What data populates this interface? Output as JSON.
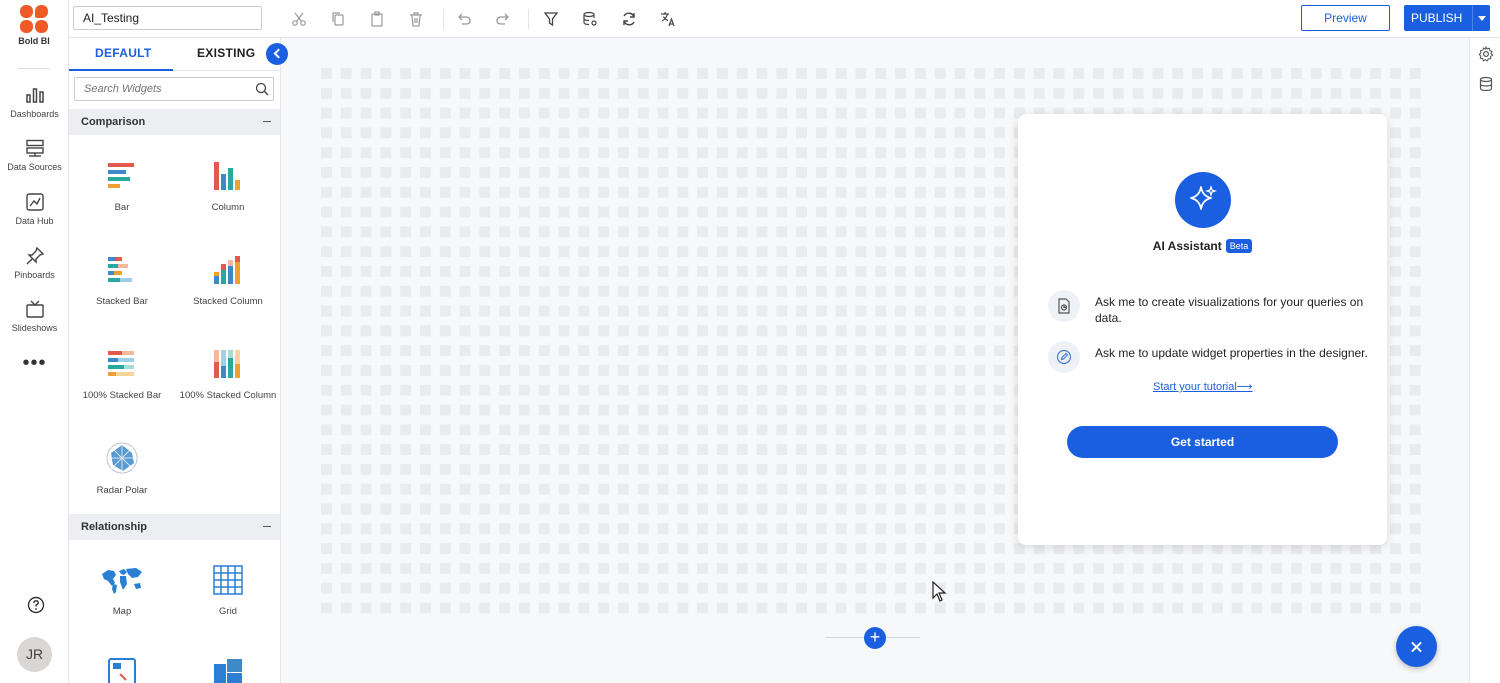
{
  "app": {
    "brand": "Bold BI"
  },
  "leftnav": {
    "items": [
      {
        "label": "Dashboards",
        "icon": "bar-chart-icon"
      },
      {
        "label": "Data Sources",
        "icon": "server-icon"
      },
      {
        "label": "Data Hub",
        "icon": "data-hub-icon"
      },
      {
        "label": "Pinboards",
        "icon": "pin-icon"
      },
      {
        "label": "Slideshows",
        "icon": "tv-icon"
      }
    ],
    "more": "•••",
    "avatar": "JR"
  },
  "toolbar": {
    "dashboard_name": "AI_Testing",
    "preview_label": "Preview",
    "publish_label": "PUBLISH"
  },
  "panel": {
    "tabs": {
      "default": "DEFAULT",
      "existing": "EXISTING"
    },
    "search_placeholder": "Search Widgets",
    "sections": [
      {
        "title": "Comparison",
        "widgets": [
          "Bar",
          "Column",
          "Stacked Bar",
          "Stacked Column",
          "100% Stacked Bar",
          "100% Stacked Column",
          "Radar Polar"
        ]
      },
      {
        "title": "Relationship",
        "widgets": [
          "Map",
          "Grid"
        ]
      }
    ]
  },
  "ai": {
    "title": "AI Assistant",
    "badge": "Beta",
    "feature1": "Ask me to create visualizations for your queries on data.",
    "feature2": "Ask me to update widget properties in the designer.",
    "tutorial": "Start your tutorial⟶",
    "cta": "Get started"
  },
  "colors": {
    "accent": "#1a5fe0",
    "brand": "#f05a28"
  }
}
